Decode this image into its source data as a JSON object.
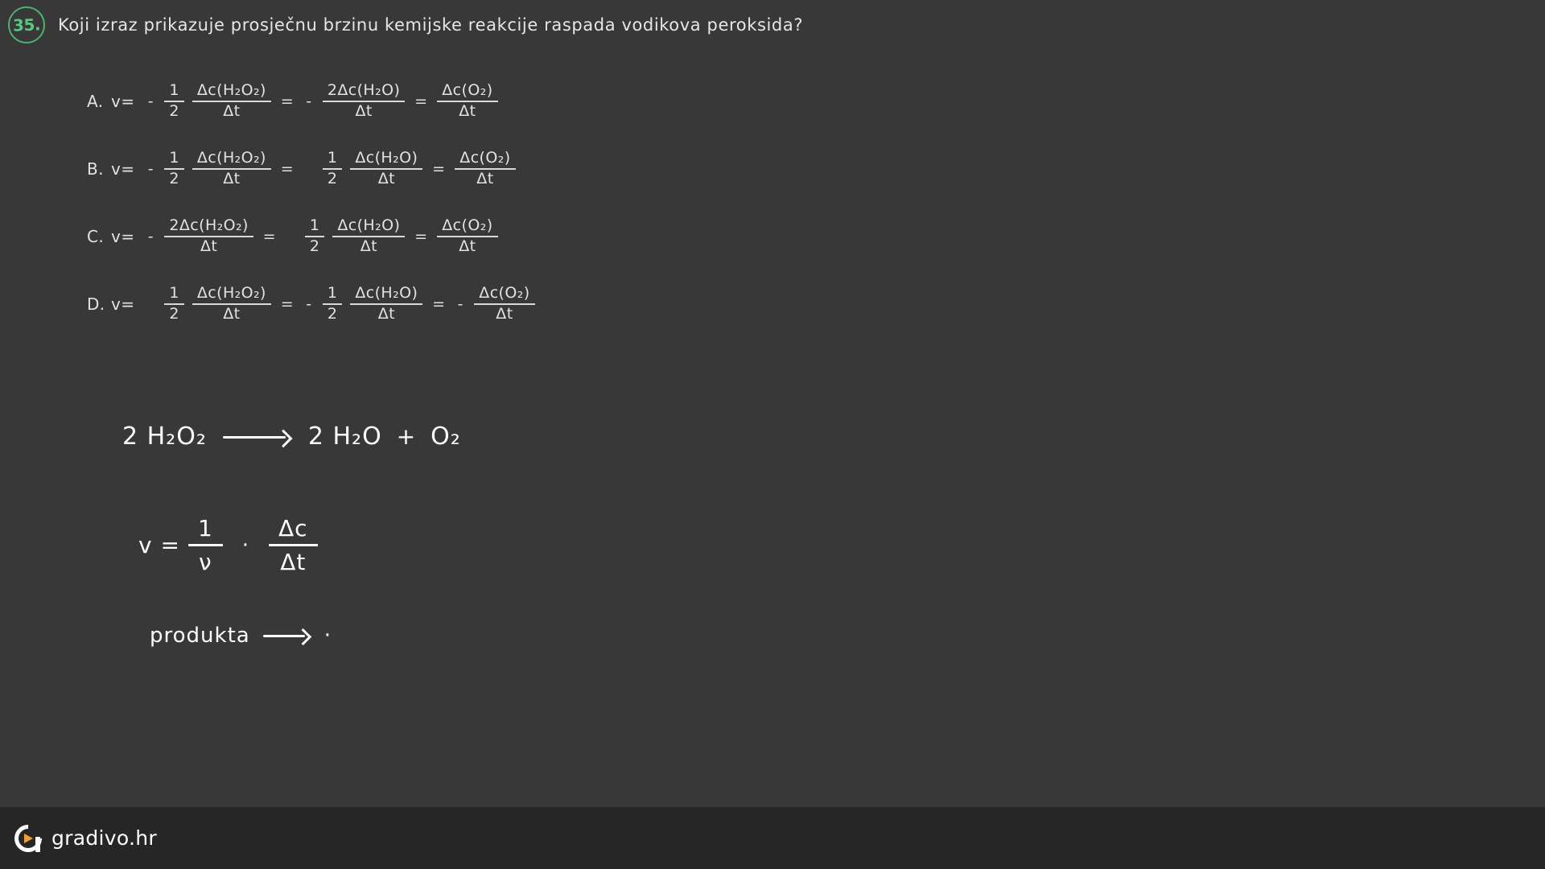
{
  "question": {
    "number": "35.",
    "text": "Koji izraz prikazuje prosječnu brzinu kemijske reakcije raspada vodikova peroksida?"
  },
  "options": [
    {
      "label": "A.",
      "v": "v=",
      "sign1": "-",
      "coef1_num": "1",
      "coef1_den": "2",
      "term1_num": "Δc(H₂O₂)",
      "term1_den": "Δt",
      "eq1": "=",
      "sign2": "-",
      "term2_num": "2Δc(H₂O)",
      "term2_den": "Δt",
      "eq2": "=",
      "sign3": "",
      "term3_num": "Δc(O₂)",
      "term3_den": "Δt"
    },
    {
      "label": "B.",
      "v": "v=",
      "sign1": "-",
      "coef1_num": "1",
      "coef1_den": "2",
      "term1_num": "Δc(H₂O₂)",
      "term1_den": "Δt",
      "eq1": "=",
      "sign2": "",
      "coef2_num": "1",
      "coef2_den": "2",
      "term2_num": "Δc(H₂O)",
      "term2_den": "Δt",
      "eq2": "=",
      "sign3": "",
      "term3_num": "Δc(O₂)",
      "term3_den": "Δt"
    },
    {
      "label": "C.",
      "v": "v=",
      "sign1": "-",
      "term1_num": "2Δc(H₂O₂)",
      "term1_den": "Δt",
      "eq1": "=",
      "sign2": "",
      "coef2_num": "1",
      "coef2_den": "2",
      "term2_num": "Δc(H₂O)",
      "term2_den": "Δt",
      "eq2": "=",
      "sign3": "",
      "term3_num": "Δc(O₂)",
      "term3_den": "Δt"
    },
    {
      "label": "D.",
      "v": "v=",
      "sign1": "",
      "coef1_num": "1",
      "coef1_den": "2",
      "term1_num": "Δc(H₂O₂)",
      "term1_den": "Δt",
      "eq1": "=",
      "sign2": "-",
      "coef2_num": "1",
      "coef2_den": "2",
      "term2_num": "Δc(H₂O)",
      "term2_den": "Δt",
      "eq2": "=",
      "sign3": "-",
      "term3_num": "Δc(O₂)",
      "term3_den": "Δt"
    }
  ],
  "handwriting": {
    "reaction": {
      "left": "2 H₂O₂",
      "arrow": "arrow-right-icon",
      "right": "2 H₂O",
      "plus": "+",
      "last": "O₂"
    },
    "formula": {
      "lhs": "v =",
      "frac1_num": "1",
      "frac1_den": "ν",
      "dot": "·",
      "frac2_num": "Δc",
      "frac2_den": "Δt"
    },
    "note": {
      "word": "produkta",
      "arrow": "arrow-right-icon",
      "dot": "·"
    }
  },
  "footer": {
    "logo_text": "gradivo.hr"
  },
  "colors": {
    "background": "#383838",
    "page_background": "#343434",
    "footer_background": "#262626",
    "badge_green": "#56c97e",
    "text": "#e6e6e6",
    "handwriting_white": "#ffffff",
    "logo_accent": "#f0a030"
  }
}
